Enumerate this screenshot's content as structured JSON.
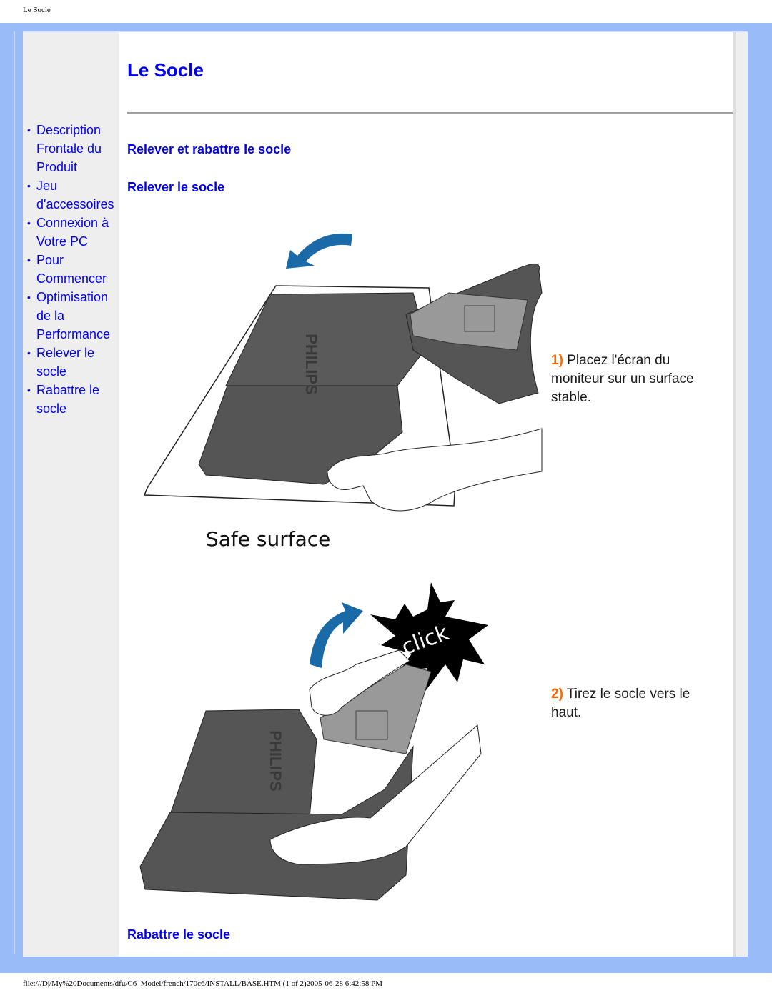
{
  "page": {
    "header_title": "Le Socle",
    "footer_path": "file:///D|/My%20Documents/dfu/C6_Model/french/170c6/INSTALL/BASE.HTM (1 of 2)2005-06-28 6:42:58 PM"
  },
  "sidebar": {
    "items": [
      {
        "label": "Description Frontale du Produit"
      },
      {
        "label": "Jeu d'accessoires"
      },
      {
        "label": "Connexion à Votre PC"
      },
      {
        "label": "Pour Commencer"
      },
      {
        "label": "Optimisation de la Performance"
      },
      {
        "label": "Relever le socle"
      },
      {
        "label": "Rabattre le socle"
      }
    ],
    "bullet": "•"
  },
  "main": {
    "title": "Le Socle",
    "section_heading": "Relever et rabattre le socle",
    "subsection_raise": "Relever le socle",
    "subsection_lower": "Rabattre le socle",
    "steps": [
      {
        "number": "1)",
        "text": " Placez l'écran du moniteur sur un surface stable."
      },
      {
        "number": "2)",
        "text": " Tirez le socle vers le haut."
      }
    ],
    "illustration_1": {
      "caption": "Safe surface",
      "brand": "PHILIPS"
    },
    "illustration_2": {
      "callout": "click",
      "brand": "PHILIPS"
    }
  },
  "colors": {
    "link": "#0000ee",
    "step_number": "#ff6600",
    "frame": "#99bbf7",
    "sidebar_bg": "#eeeeee",
    "arrow": "#1a6aa8"
  }
}
